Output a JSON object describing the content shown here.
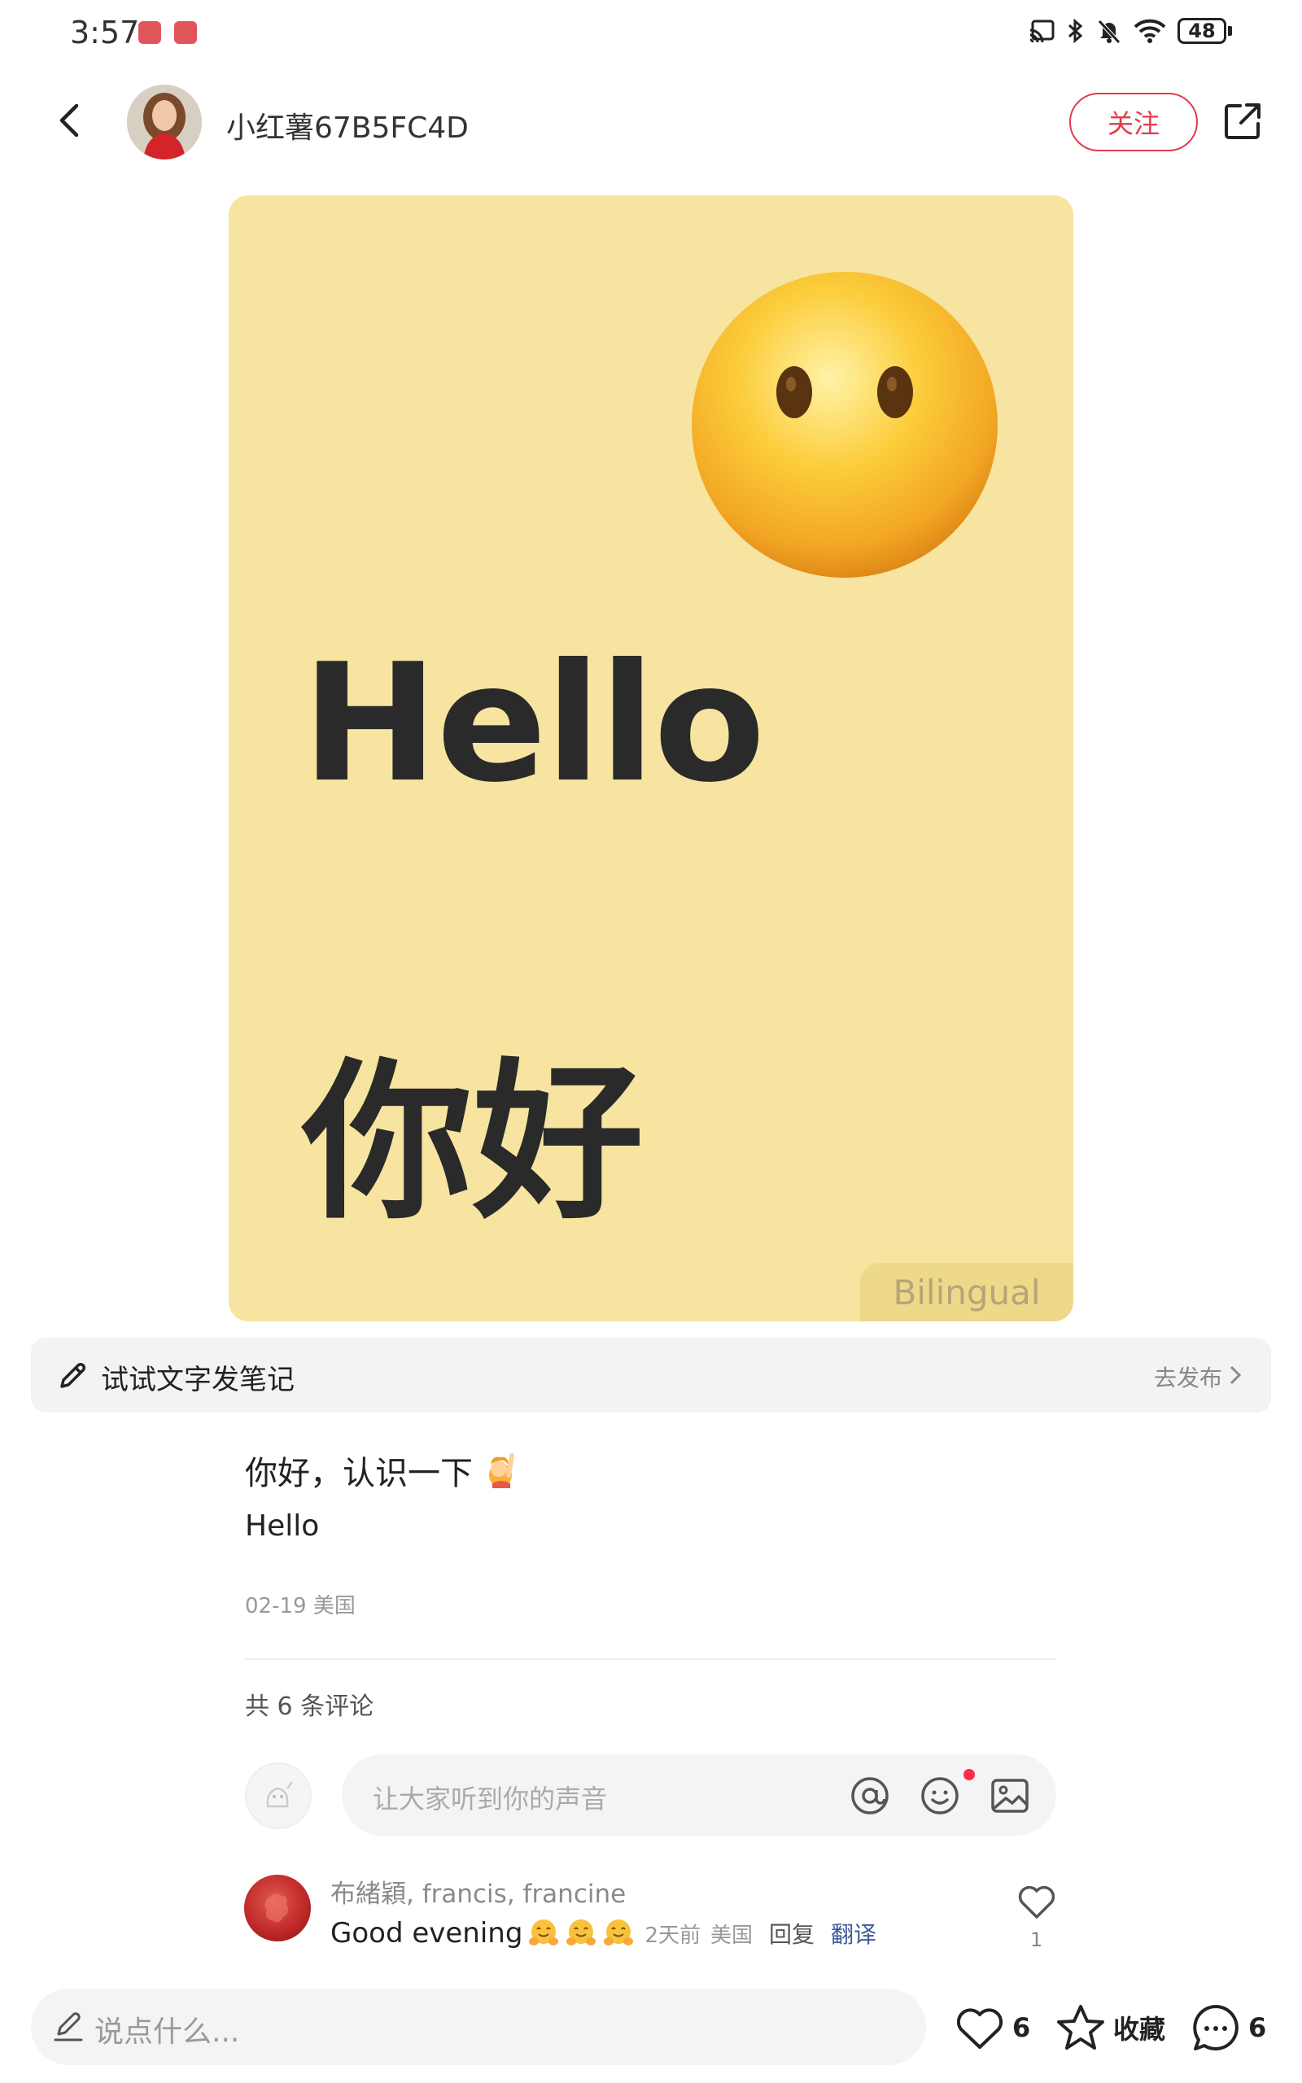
{
  "status_bar": {
    "time": "3:57",
    "battery": "48",
    "icons": [
      "cast-icon",
      "bluetooth-icon",
      "mute-icon",
      "wifi-icon",
      "battery-icon"
    ]
  },
  "header": {
    "username": "小红薯67B5FC4D",
    "follow_label": "关注",
    "icons": [
      "back-icon",
      "share-icon"
    ]
  },
  "post_image": {
    "hello": "Hello",
    "nihao": "你好",
    "tag": "Bilingual",
    "background_color": "#f6e4a0",
    "emoji": "face-without-mouth"
  },
  "try_note": {
    "label": "试试文字发笔记",
    "action": "去发布"
  },
  "post": {
    "title": "你好，认识一下",
    "title_emoji": "raising-hand-icon",
    "body": "Hello",
    "meta": "02-19 美国"
  },
  "comments": {
    "count_label": "共 6 条评论",
    "input_placeholder": "让大家听到你的声音",
    "items": [
      {
        "author": "布緒穎, francis, francine",
        "text": "Good evening",
        "emojis": [
          "hug-icon",
          "hug-icon",
          "hug-icon"
        ],
        "time": "2天前",
        "location": "美国",
        "reply_label": "回复",
        "translate_label": "翻译",
        "likes": "1"
      }
    ]
  },
  "bottom_bar": {
    "placeholder": "说点什么...",
    "likes": "6",
    "collect_label": "收藏",
    "comments": "6"
  },
  "colors": {
    "accent": "#e33b4b",
    "card": "#f6e4a0",
    "link": "#3b5a99"
  }
}
